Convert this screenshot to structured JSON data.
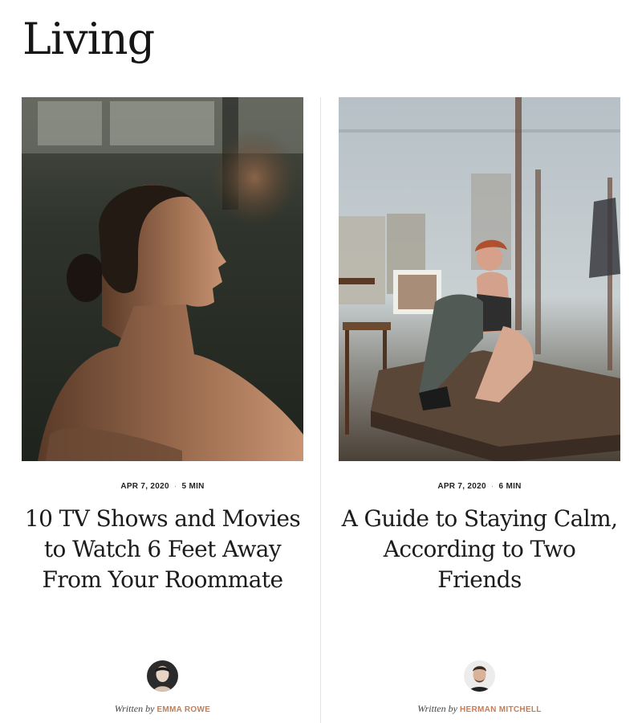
{
  "section": {
    "title": "Living"
  },
  "articles": [
    {
      "date": "APR 7, 2020",
      "read_time": "5 MIN",
      "title": "10 TV Shows and Movies to Watch 6 Feet Away From Your Roommate",
      "byline_prefix": "Written by",
      "author": "EMMA ROWE"
    },
    {
      "date": "APR 7, 2020",
      "read_time": "6 MIN",
      "title": "A Guide to Staying Calm, According to Two Friends",
      "byline_prefix": "Written by",
      "author": "HERMAN MITCHELL"
    }
  ],
  "colors": {
    "author_link": "#c47d56",
    "divider": "#e3e3e3"
  }
}
